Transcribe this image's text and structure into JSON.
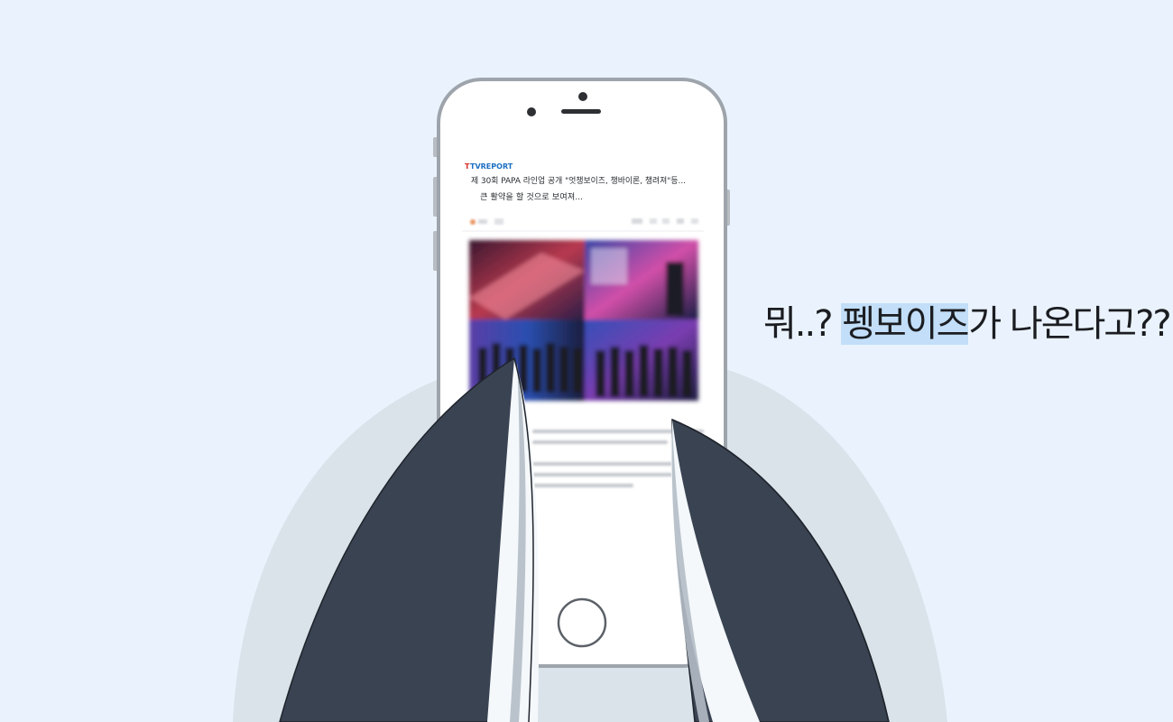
{
  "article": {
    "source_logo": "TVREPORT",
    "headline_line1": "제 30회 PAPA 라인업 공개 \"엇챙보이즈, 챙바이론, 챙려져\"등...",
    "headline_line2": "큰 활약을 할 것으로 보여져..."
  },
  "caption": {
    "prefix": "뭐..? ",
    "highlight": "펭보이즈",
    "suffix": "가 나온다고??"
  },
  "colors": {
    "background": "#eaf3fd",
    "phone_outline": "#9ea4ab",
    "wing_dark": "#3a4352",
    "wing_light": "#f4f8fb",
    "body_shade": "#dae2ea",
    "highlight": "#c2def8",
    "logo_blue": "#1b6fc2",
    "logo_red": "#d9302c"
  }
}
